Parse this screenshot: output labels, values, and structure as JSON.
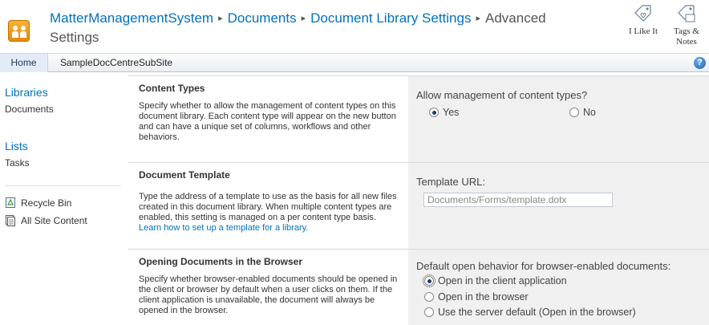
{
  "header": {
    "breadcrumb": [
      {
        "label": "MatterManagementSystem",
        "link": true
      },
      {
        "label": "Documents",
        "link": true
      },
      {
        "label": "Document Library Settings",
        "link": true
      },
      {
        "label": "Advanced",
        "link": false
      }
    ],
    "breadcrumb_separator": "▸",
    "breadcrumb_current_line2": "Settings",
    "actions": {
      "i_like_it": "I Like It",
      "tags_notes_line1": "Tags &",
      "tags_notes_line2": "Notes"
    }
  },
  "topnav": {
    "home": "Home",
    "subsite": "SampleDocCentreSubSite",
    "help": "?"
  },
  "leftnav": {
    "libraries_heading": "Libraries",
    "documents": "Documents",
    "lists_heading": "Lists",
    "tasks": "Tasks",
    "recycle_bin": "Recycle Bin",
    "all_site_content": "All Site Content"
  },
  "sections": {
    "content_types": {
      "title": "Content Types",
      "description": "Specify whether to allow the management of content types on this document library. Each content type will appear on the new button and can have a unique set of columns, workflows and other behaviors.",
      "field_label": "Allow management of content types?",
      "options": [
        {
          "label": "Yes",
          "checked": true
        },
        {
          "label": "No",
          "checked": false
        }
      ]
    },
    "document_template": {
      "title": "Document Template",
      "description": "Type the address of a template to use as the basis for all new files created in this document library. When multiple content types are enabled, this setting is managed on a per content type basis.",
      "link_text": "Learn how to set up a template for a library.",
      "field_label": "Template URL:",
      "template_url": "Documents/Forms/template.dotx"
    },
    "opening_documents": {
      "title": "Opening Documents in the Browser",
      "description": "Specify whether browser-enabled documents should be opened in the client or browser by default when a user clicks on them. If the client application is unavailable, the document will always be opened in the browser.",
      "field_label": "Default open behavior for browser-enabled documents:",
      "options": [
        {
          "label": "Open in the client application",
          "checked": true
        },
        {
          "label": "Open in the browser",
          "checked": false
        },
        {
          "label": "Use the server default (Open in the browser)",
          "checked": false
        }
      ]
    }
  },
  "colors": {
    "link": "#0072bc",
    "field_bg": "#f0f0f0",
    "site_icon": "#f2a52a"
  },
  "icons": {
    "site": "site-logo-icon",
    "i_like_it": "tag-heart-icon",
    "tags_notes": "tag-notes-icon",
    "help": "help-icon",
    "recycle_bin": "recycle-bin-icon",
    "all_site_content": "site-content-icon"
  }
}
